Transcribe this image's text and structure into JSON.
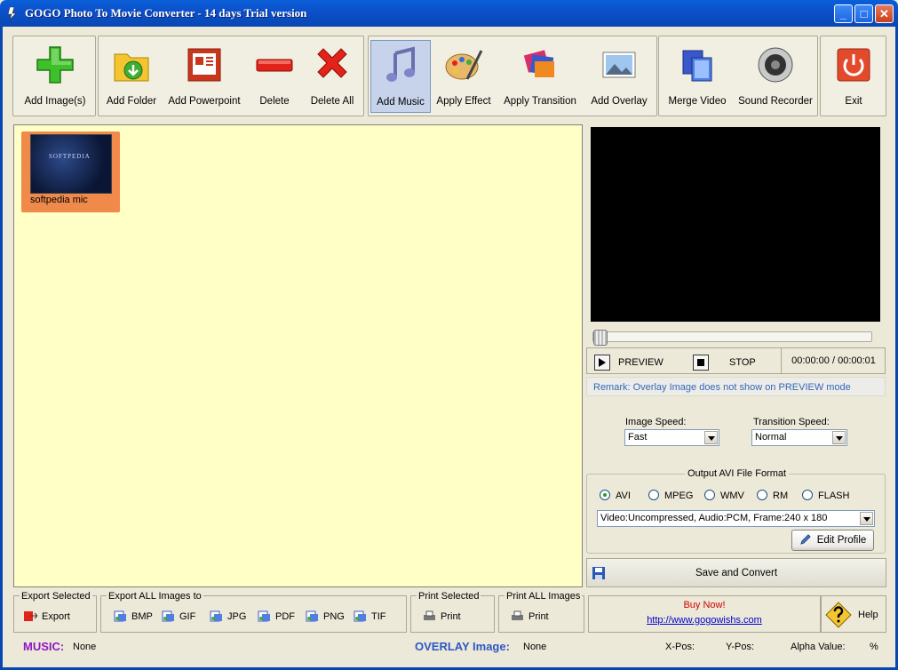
{
  "window": {
    "title": "GOGO Photo To Movie Converter - 14 days Trial version"
  },
  "toolbar": {
    "add_images": "Add Image(s)",
    "add_folder": "Add Folder",
    "add_powerpoint": "Add Powerpoint",
    "delete": "Delete",
    "delete_all": "Delete All",
    "add_music": "Add Music",
    "apply_effect": "Apply Effect",
    "apply_transition": "Apply Transition",
    "add_overlay": "Add Overlay",
    "merge_video": "Merge Video",
    "sound_recorder": "Sound Recorder",
    "exit": "Exit"
  },
  "images": [
    {
      "caption": "softpedia mic",
      "thumb_text": "SOFTPEDIA"
    }
  ],
  "player": {
    "preview_label": "PREVIEW",
    "stop_label": "STOP",
    "time": "00:00:00 / 00:00:01",
    "position_fraction": 0,
    "remark": "Remark: Overlay Image does not show on PREVIEW mode"
  },
  "speed": {
    "image_label": "Image Speed:",
    "image_value": "Fast",
    "transition_label": "Transition Speed:",
    "transition_value": "Normal"
  },
  "output": {
    "legend": "Output AVI File Format",
    "formats": [
      "AVI",
      "MPEG",
      "WMV",
      "RM",
      "FLASH"
    ],
    "selected": "AVI",
    "profile": "Video:Uncompressed, Audio:PCM, Frame:240 x 180",
    "edit_profile": "Edit Profile",
    "save_convert": "Save and Convert"
  },
  "bottom": {
    "export_selected_label": "Export Selected",
    "export_button": "Export",
    "export_all_label": "Export ALL Images to",
    "export_all": [
      "BMP",
      "GIF",
      "JPG",
      "PDF",
      "PNG",
      "TIF"
    ],
    "print_selected_label": "Print Selected",
    "print_all_label": "Print ALL Images",
    "print_button": "Print",
    "buy_now": "Buy Now!",
    "url": "http://www.gogowishs.com",
    "help": "Help"
  },
  "status": {
    "music_label": "MUSIC:",
    "music_value": "None",
    "overlay_label": "OVERLAY Image:",
    "overlay_value": "None",
    "xpos_label": "X-Pos:",
    "ypos_label": "Y-Pos:",
    "alpha_label": "Alpha Value:",
    "percent": "%"
  }
}
